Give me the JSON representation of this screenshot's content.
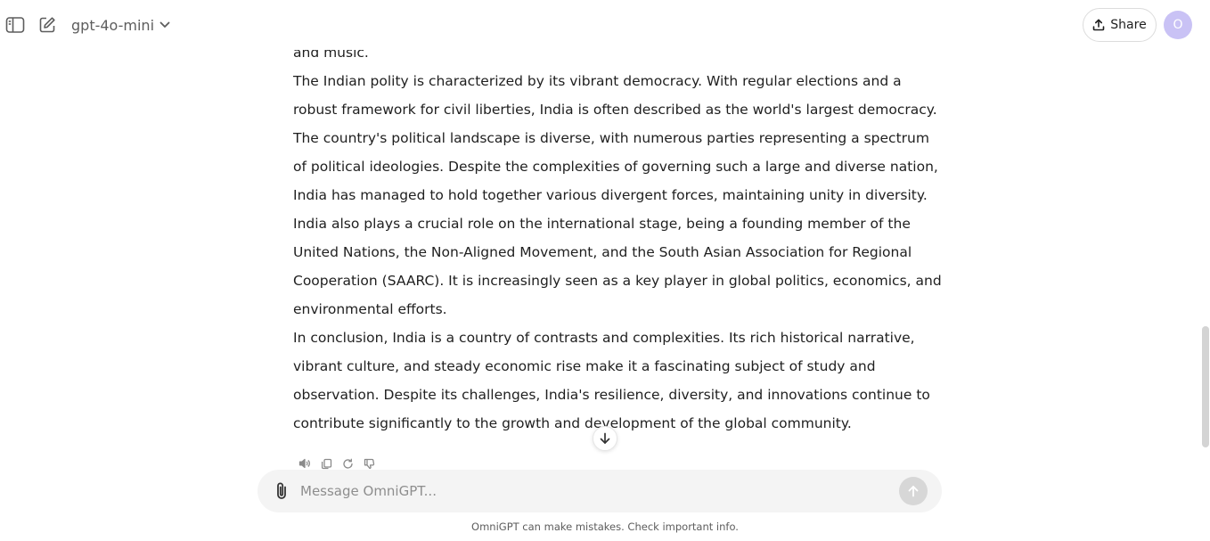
{
  "header": {
    "model_name": "gpt-4o-mini",
    "share_label": "Share",
    "avatar_initial": "O"
  },
  "conversation": {
    "paragraphs": [
      "and music.",
      "The Indian polity is characterized by its vibrant democracy. With regular elections and a robust framework for civil liberties, India is often described as the world's largest democracy. The country's political landscape is diverse, with numerous parties representing a spectrum of political ideologies. Despite the complexities of governing such a large and diverse nation, India has managed to hold together various divergent forces, maintaining unity in diversity.",
      "India also plays a crucial role on the international stage, being a founding member of the United Nations, the Non-Aligned Movement, and the South Asian Association for Regional Cooperation (SAARC). It is increasingly seen as a key player in global politics, economics, and environmental efforts.",
      "In conclusion, India is a country of contrasts and complexities. Its rich historical narrative, vibrant culture, and steady economic rise make it a fascinating subject of study and observation. Despite its challenges, India's resilience, diversity, and innovations continue to contribute significantly to the growth and development of the global community."
    ]
  },
  "composer": {
    "placeholder": "Message OmniGPT..."
  },
  "footer": {
    "disclaimer": "OmniGPT can make mistakes. Check important info."
  },
  "colors": {
    "avatar_bg": "#c9c2f5",
    "composer_bg": "#f4f4f4",
    "send_button_bg": "#d7d7d7"
  },
  "icons": {
    "sidebar_toggle": "sidebar-icon",
    "new_chat": "edit-icon",
    "model_dropdown": "chevron-down-icon",
    "share": "upload-icon",
    "scroll_down": "arrow-down-icon",
    "read_aloud": "speaker-icon",
    "copy": "copy-icon",
    "regenerate": "refresh-icon",
    "dislike": "thumbs-down-icon",
    "attach": "paperclip-icon",
    "send": "arrow-up-icon"
  }
}
